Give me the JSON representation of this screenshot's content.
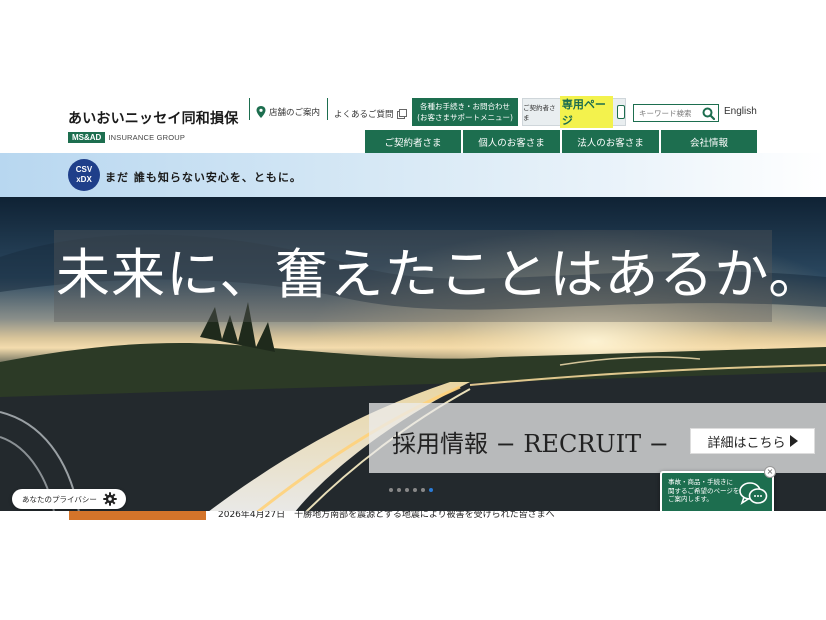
{
  "header": {
    "logo_name": "あいおいニッセイ同和損保",
    "logo_msad": "MS&AD",
    "logo_group": "INSURANCE GROUP",
    "store_link": "店舗のご案内",
    "faq_link": "よくあるご質問",
    "support_line1": "各種お手続き・お問合わせ",
    "support_line2": "(お客さまサポートメニュー)",
    "member_small": "ご契約者さま",
    "member_big": "専用ページ",
    "search_placeholder": "キーワード検索",
    "english": "English"
  },
  "nav": {
    "tabs": [
      "ご契約者さま",
      "個人のお客さま",
      "法人のお客さま",
      "会社情報"
    ]
  },
  "strip": {
    "badge_top": "CSV",
    "badge_bottom": "xDX",
    "tagline": "まだ 誰も知らない安心を、ともに。"
  },
  "hero": {
    "headline": "未来に、奮えたことはあるか。",
    "recruit": "採用情報 − RECRUIT −",
    "detail_button": "詳細はこちら",
    "slide_count": 6,
    "active_slide": 5
  },
  "privacy": {
    "label": "あなたのプライバシー"
  },
  "chat": {
    "line1": "事故・商品・手続きに",
    "line2": "関するご希望のページを",
    "line3": "ご案内します。",
    "close": "×"
  },
  "news": {
    "text": "2026年4月27日　十勝地方南部を震源とする地震により被害を受けられた皆さまへ"
  },
  "colors": {
    "brand_green": "#1d6e4f",
    "news_orange": "#d4742a",
    "badge_blue": "#1f3f8a"
  }
}
